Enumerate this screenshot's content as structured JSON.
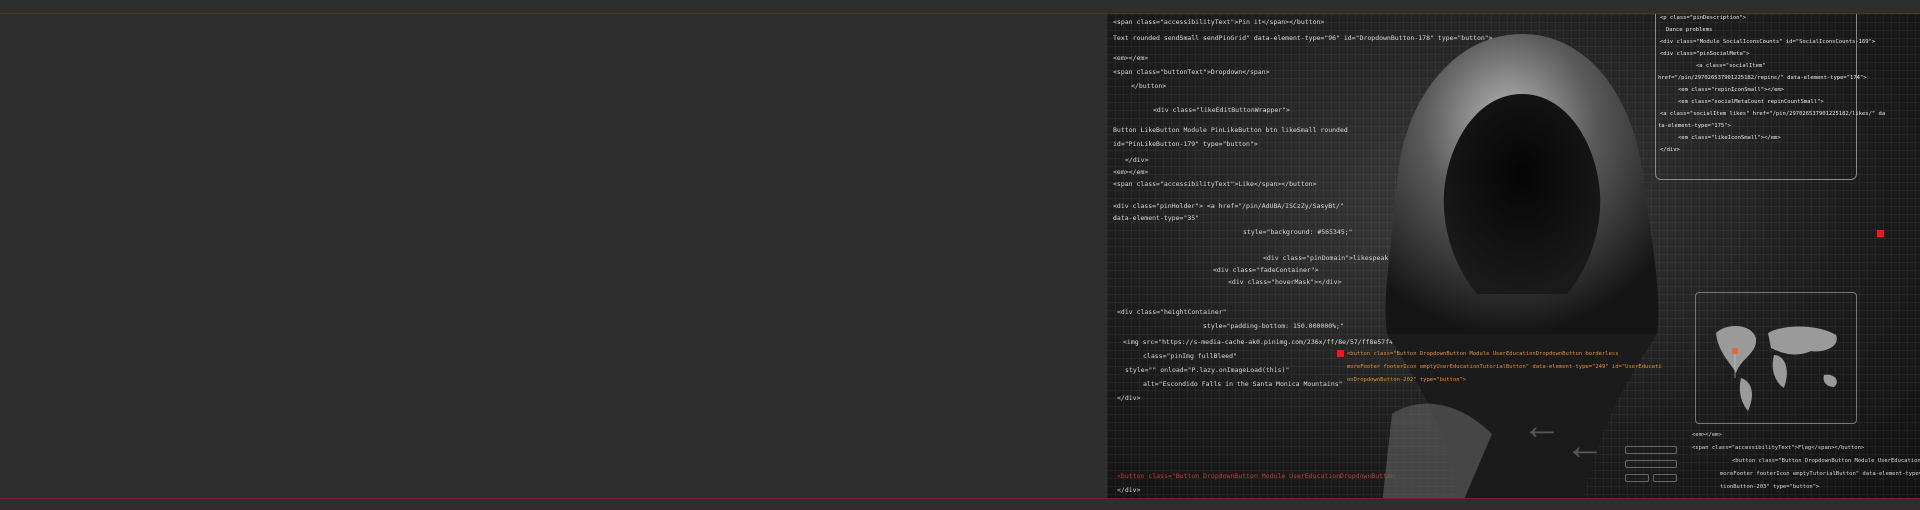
{
  "banner": {
    "code_lines": [
      {
        "text": "<span class=\"accessibilityText\">Pin it</span></button>",
        "style": "bright"
      },
      {
        "text": "Text rounded sendSmall sendPinGrid\" data-element-type=\"96\" id=\"DropdownButton-178\" type=\"button\">",
        "style": "bright"
      },
      {
        "text": "<em></em>",
        "style": "bright"
      },
      {
        "text": "<span class=\"buttonText\">Dropdown</span>",
        "style": "bright"
      },
      {
        "text": "</button>",
        "style": "bright"
      },
      {
        "text": "<div class=\"likeEditButtonWrapper\">",
        "style": "bright"
      },
      {
        "text": "Button LikeButton Module PinLikeButton btn likeSmall rounded",
        "style": "bright"
      },
      {
        "text": "id=\"PinLikeButton-179\" type=\"button\">",
        "style": "bright"
      },
      {
        "text": "</div>",
        "style": "bright"
      },
      {
        "text": "<em></em>",
        "style": "bright"
      },
      {
        "text": "<span class=\"accessibilityText\">Like</span></button>",
        "style": "bright"
      },
      {
        "text": "<div class=\"pinHolder\">  <a href=\"/pin/AdUBA/ISCzZy/SasyBt/\"",
        "style": "bright"
      },
      {
        "text": "data-element-type=\"35\"",
        "style": "bright"
      },
      {
        "text": "style=\"background: #565345;\"",
        "style": "bright"
      },
      {
        "text": "<div class=\"pinDomain\">likespeak.com</div>",
        "style": "bright"
      },
      {
        "text": "<div class=\"fadeContainer\">",
        "style": "bright"
      },
      {
        "text": "<div class=\"hoverMask\"></div>",
        "style": "bright"
      },
      {
        "text": "<div class=\"heightContainer\"",
        "style": "bright"
      },
      {
        "text": "style=\"padding-bottom: 150.000000%;\"",
        "style": "bright"
      },
      {
        "text": "<img     src=\"https://s-media-cache-ak0.pinimg.com/236x/ff/8e/57/ff8e57f472c9d46f14cb6.jpg\"",
        "style": "bright"
      },
      {
        "text": "class=\"pinImg fullBleed\"",
        "style": "bright"
      },
      {
        "text": "style=\"\"     onload=\"P.lazy.onImageLoad(this)\"",
        "style": "bright"
      },
      {
        "text": "alt=\"Escondido Falls in the Santa Monica Mountains\"",
        "style": "bright"
      },
      {
        "text": "</div>",
        "style": "bright"
      },
      {
        "text": "<button class=\"Button DropdownButton Module UserEducationDropdownButton",
        "style": "red"
      },
      {
        "text": "</div>",
        "style": "bright"
      }
    ],
    "panel_lines": [
      "<p class=\"pinDescription\">",
      "Dance problems",
      "<div class=\"Module SocialIconsCounts\" id=\"SocialIconsCounts-169\">",
      "<div class=\"pinSocialMeta\">",
      "<a class=\"socialItem\"",
      "href=\"/pin/297026537901225182/repins/\" data-element-type=\"174\">",
      "<em class=\"repinIconSmall\"></em>",
      "<em class=\"socialMetaCount repinCountSmall\">",
      "<a class=\"socialItem likes\" href=\"/pin/297026537901225182/likes/\" da",
      "ta-element-type=\"175\">",
      "<em class=\"likeIconSmall\"></em>",
      "</div>"
    ],
    "highlight_lines": [
      "<button class=\"Button DropdownButton Module UserEducationDropdownButton borderless",
      "moreFooter footerIcon emptyUserEducationTutorialButton\" data-element-type=\"249\" id=\"UserEducati",
      "onDropdownButton-202\" type=\"button\">"
    ],
    "bottom_right_lines": [
      "<em></em>",
      "<span class=\"accessibilityText\">Flag</span></button>",
      "<button class=\"Button DropdownButton Module UserEducationDropdownButton b",
      "moreFooter footerIcon emptyTutorialButton\" data-element-type=\"249\" id=\"UserEdu",
      "tionButton-203\" type=\"button\">"
    ]
  }
}
